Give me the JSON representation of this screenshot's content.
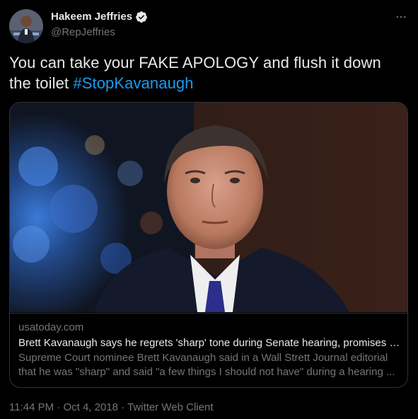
{
  "author": {
    "name": "Hakeem Jeffries",
    "handle": "@RepJeffries",
    "verified_icon": "verified-badge-icon"
  },
  "more_icon": "more-options-icon",
  "tweet": {
    "text": "You can take your FAKE APOLOGY and flush it down the toilet ",
    "hashtag": "#StopKavanaugh"
  },
  "link_card": {
    "domain": "usatoday.com",
    "title": "Brett Kavanaugh says he regrets 'sharp' tone during Senate hearing, promises t...",
    "description": "Supreme Court nominee Brett Kavanaugh said in a Wall Strett Journal editorial that he was \"sharp\" and said \"a few things I should not have\" during a hearing ..."
  },
  "meta": {
    "time": "11:44 PM",
    "date": "Oct 4, 2018",
    "source": "Twitter Web Client",
    "separator": " · "
  },
  "colors": {
    "background": "#000000",
    "text": "#e7e9ea",
    "secondary": "#71767b",
    "accent": "#1d9bf0",
    "border": "#2f3336"
  }
}
